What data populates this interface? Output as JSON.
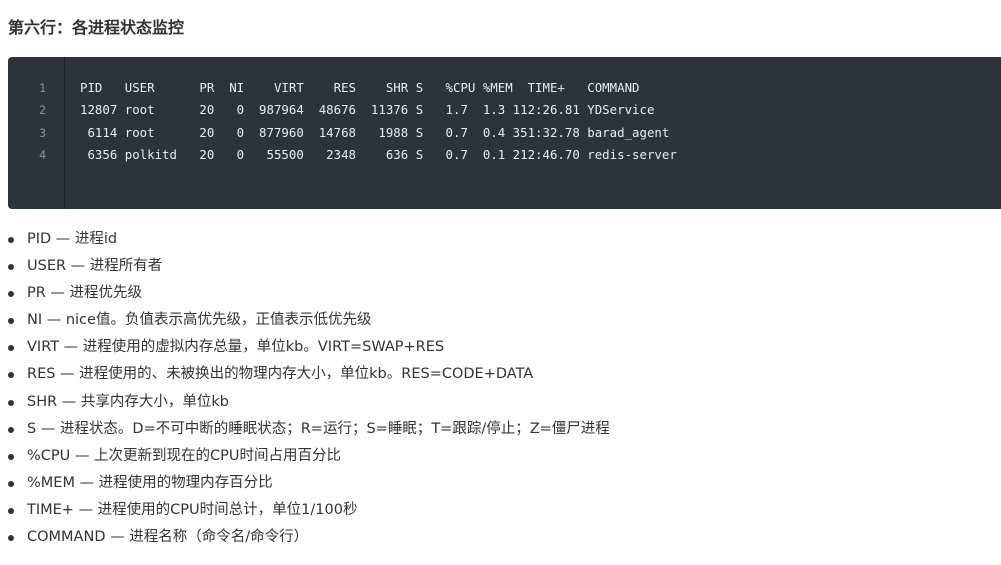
{
  "heading": "第六行：各进程状态监控",
  "code": {
    "line_numbers": [
      "1",
      "2",
      "3",
      "4"
    ],
    "lines": [
      "PID   USER      PR  NI    VIRT    RES    SHR S   %CPU %MEM  TIME+   COMMAND",
      "12807 root      20   0  987964  48676  11376 S   1.7  1.3 112:26.81 YDService",
      " 6114 root      20   0  877960  14768   1988 S   0.7  0.4 351:32.78 barad_agent",
      " 6356 polkitd   20   0   55500   2348    636 S   0.7  0.1 212:46.70 redis-server"
    ]
  },
  "bullets": [
    "PID — 进程id",
    "USER — 进程所有者",
    "PR — 进程优先级",
    "NI — nice值。负值表示高优先级，正值表示低优先级",
    "VIRT — 进程使用的虚拟内存总量，单位kb。VIRT=SWAP+RES",
    "RES — 进程使用的、未被换出的物理内存大小，单位kb。RES=CODE+DATA",
    "SHR — 共享内存大小，单位kb",
    "S — 进程状态。D=不可中断的睡眠状态；R=运行；S=睡眠；T=跟踪/停止；Z=僵尸进程",
    "%CPU — 上次更新到现在的CPU时间占用百分比",
    "%MEM — 进程使用的物理内存百分比",
    "TIME+ — 进程使用的CPU时间总计，单位1/100秒",
    "COMMAND — 进程名称（命令名/命令行）"
  ]
}
